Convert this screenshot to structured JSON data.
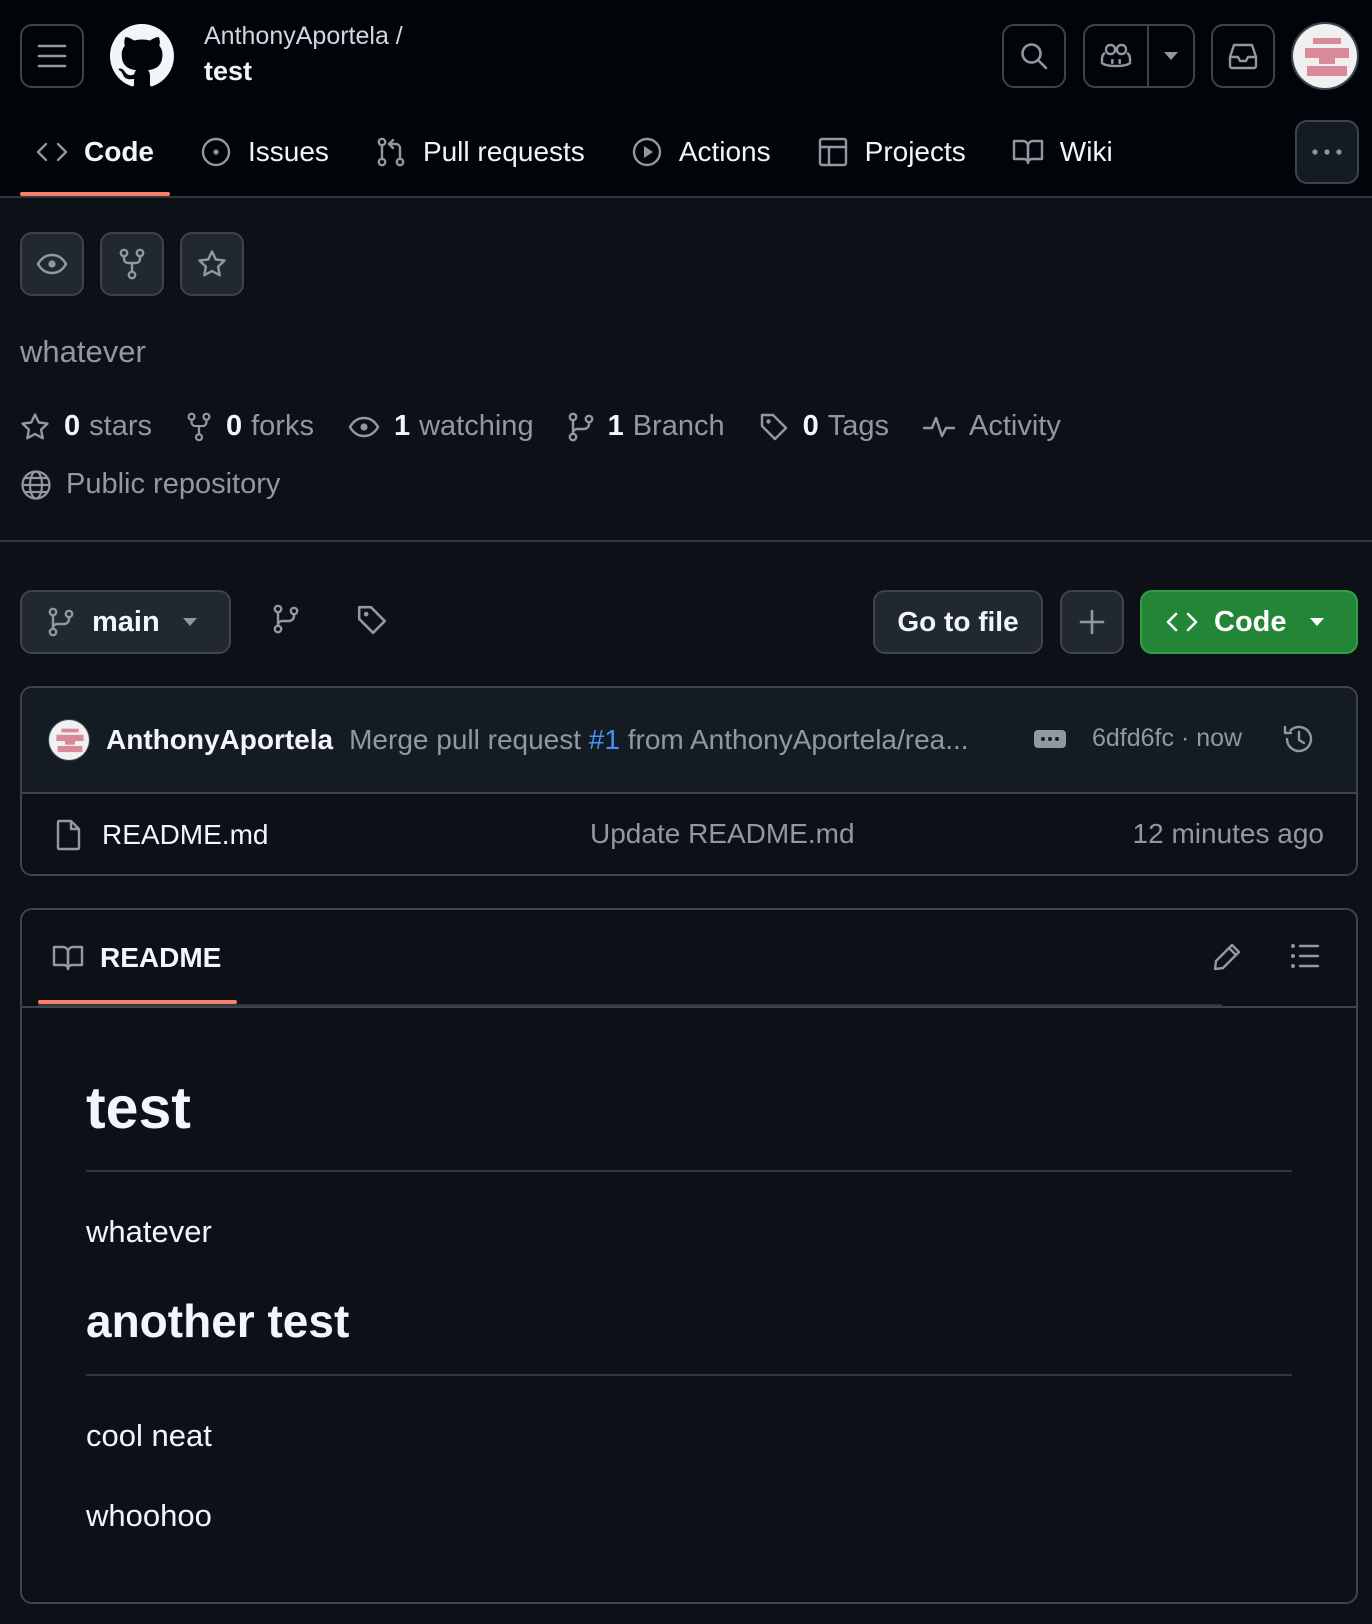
{
  "header": {
    "owner": "AnthonyAportela /",
    "repo_name": "test"
  },
  "tabs": [
    {
      "label": "Code",
      "icon": "code-icon",
      "active": true
    },
    {
      "label": "Issues",
      "icon": "issue-opened-icon"
    },
    {
      "label": "Pull requests",
      "icon": "git-pull-request-icon"
    },
    {
      "label": "Actions",
      "icon": "play-icon"
    },
    {
      "label": "Projects",
      "icon": "table-icon"
    },
    {
      "label": "Wiki",
      "icon": "book-icon"
    }
  ],
  "repo": {
    "description": "whatever",
    "stats": [
      {
        "count": "0",
        "label": "stars",
        "icon": "star-icon"
      },
      {
        "count": "0",
        "label": "forks",
        "icon": "repo-forked-icon"
      },
      {
        "count": "1",
        "label": "watching",
        "icon": "eye-icon"
      },
      {
        "count": "1",
        "label": "Branch",
        "icon": "git-branch-icon"
      },
      {
        "count": "0",
        "label": "Tags",
        "icon": "tag-icon"
      },
      {
        "count": "",
        "label": "Activity",
        "icon": "pulse-icon"
      }
    ],
    "visibility": "Public repository"
  },
  "toolbar": {
    "branch": "main",
    "go_to_file": "Go to file",
    "code_button": "Code"
  },
  "commit": {
    "author": "AnthonyAportela",
    "message_prefix": "Merge pull request ",
    "pr_number": "#1",
    "message_suffix": " from AnthonyAportela/rea...",
    "sha_time": "6dfd6fc · now"
  },
  "files": [
    {
      "name": "README.md",
      "message": "Update README.md",
      "time": "12 minutes ago"
    }
  ],
  "readme": {
    "tab_label": "README",
    "h1": "test",
    "p1": "whatever",
    "h2": "another test",
    "p2": "cool neat",
    "p3": "whoohoo"
  },
  "colors": {
    "background": "#0d1117",
    "header_background": "#010409",
    "accent_underline": "#f78166",
    "code_button": "#238636",
    "link": "#4493f8"
  }
}
